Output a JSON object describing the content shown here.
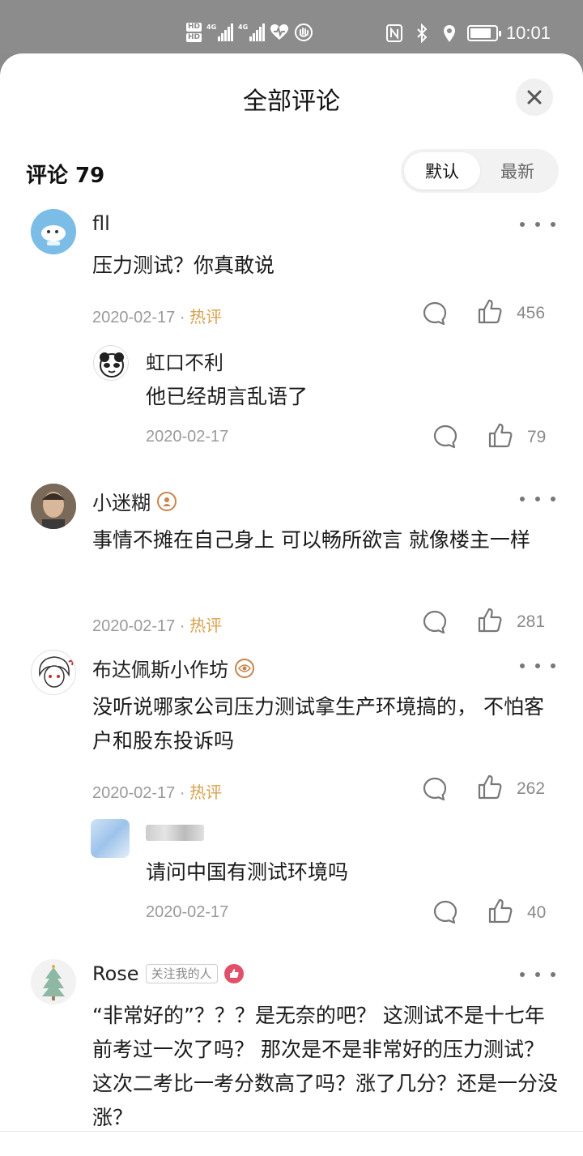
{
  "status_bar": {
    "hd1": "HD",
    "hd2": "HD",
    "net1": "4G",
    "net2": "4G",
    "time": "10:01",
    "battery_level": 0.85
  },
  "sheet": {
    "title": "全部评论",
    "count_label": "评论 79",
    "sort_default": "默认",
    "sort_latest": "最新"
  },
  "comments": [
    {
      "user": "fll",
      "text": "压力测试？你真敢说",
      "date": "2020-02-17",
      "sep": " · ",
      "hot": "热评",
      "likes": "456",
      "replies": [
        {
          "user": "虹口不利",
          "text": "他已经胡言乱语了",
          "date": "2020-02-17",
          "likes": "79"
        }
      ]
    },
    {
      "user": "小迷糊",
      "text": "事情不摊在自己身上 可以畅所欲言 就像楼主一样",
      "date": "2020-02-17",
      "sep": " · ",
      "hot": "热评",
      "likes": "281"
    },
    {
      "user": "布达佩斯小作坊",
      "text": "没听说哪家公司压力测试拿生产环境搞的， 不怕客户和股东投诉吗",
      "date": "2020-02-17",
      "sep": " · ",
      "hot": "热评",
      "likes": "262",
      "replies": [
        {
          "user": "",
          "text": "请问中国有测试环境吗",
          "date": "2020-02-17",
          "likes": "40"
        }
      ]
    },
    {
      "user": "Rose",
      "tag": "关注我的人",
      "text": "“非常好的”？？？是无奈的吧？ 这测试不是十七年前考过一次了吗？ 那次是不是非常好的压力测试？这次二考比一考分数高了吗？涨了几分？还是一分没涨？"
    }
  ],
  "colors": {
    "hot": "#d7a24d",
    "meta": "#9a9a9a",
    "badge_orange": "#c9844a",
    "badge_pink": "#e0506a"
  }
}
